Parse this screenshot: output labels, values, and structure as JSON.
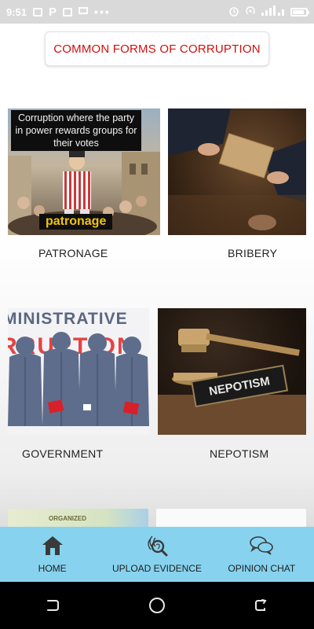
{
  "status_bar": {
    "time": "9:51",
    "parking_glyph": "P",
    "dots": "•••"
  },
  "header": {
    "title": "COMMON FORMS OF CORRUPTION"
  },
  "cards": [
    {
      "label": "PATRONAGE",
      "image_caption": "Corruption where the party in power rewards groups for their votes",
      "image_tag": "patronage"
    },
    {
      "label": "BRIBERY"
    },
    {
      "label": "GOVERNMENT",
      "image_text_top": "MINISTRATIVE",
      "image_text_red": "RRUPTION"
    },
    {
      "label": "NEPOTISM",
      "image_sign": "NEPOTISM"
    }
  ],
  "partial_cards": {
    "left_text": "ORGANIZED"
  },
  "bottom_nav": {
    "items": [
      {
        "label": "HOME",
        "icon": "home-icon"
      },
      {
        "label": "UPLOAD EVIDENCE",
        "icon": "evidence-search-icon"
      },
      {
        "label": "OPINION CHAT",
        "icon": "chat-bubbles-icon"
      }
    ]
  },
  "colors": {
    "header_text": "#d10f0f",
    "bottom_nav_bg": "#87d3ef",
    "status_bar_bg": "#d9d9d9",
    "patronage_tag": "#f2c40a"
  },
  "battery_level": 0.85
}
